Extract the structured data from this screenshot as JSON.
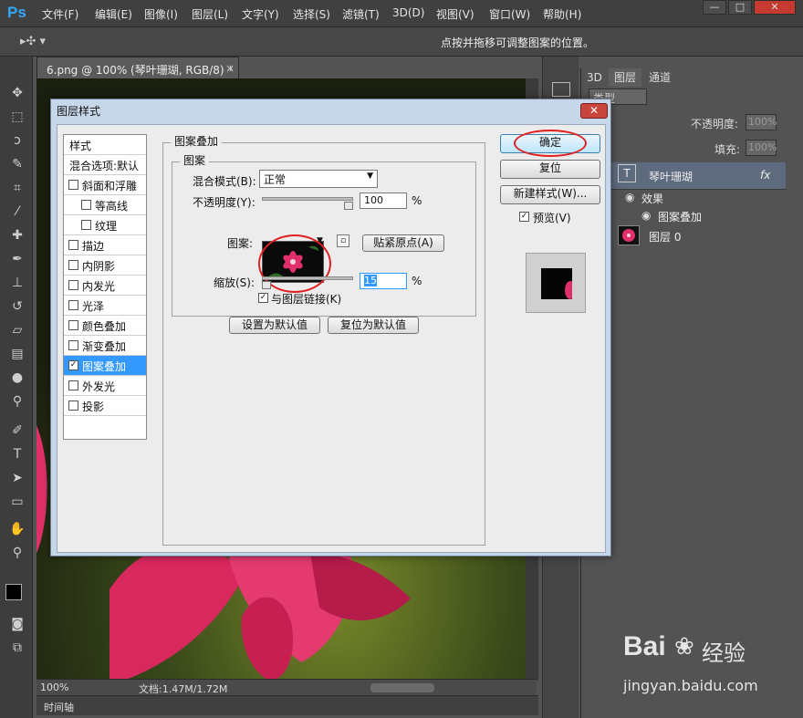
{
  "app": {
    "logo": "Ps"
  },
  "menu": [
    "文件(F)",
    "编辑(E)",
    "图像(I)",
    "图层(L)",
    "文字(Y)",
    "选择(S)",
    "滤镜(T)",
    "3D(D)",
    "视图(V)",
    "窗口(W)",
    "帮助(H)"
  ],
  "window_controls": {
    "minimize": "—",
    "maximize": "□",
    "close": "✕"
  },
  "options_bar": {
    "hint": "点按并拖移可调整图案的位置。"
  },
  "document": {
    "tab_title": "6.png @ 100% (琴叶珊瑚, RGB/8) *",
    "tab_close": "×"
  },
  "status": {
    "zoom": "100%",
    "doc_info": "文档:1.47M/1.72M"
  },
  "timeline": {
    "label": "时间轴"
  },
  "panel": {
    "tabs": [
      "3D",
      "图层",
      "通道"
    ],
    "filter_kind": "类型",
    "opacity_label": "不透明度:",
    "opacity_value": "100%",
    "fill_label": "填充:",
    "fill_value": "100%",
    "layers": [
      {
        "name": "琴叶珊瑚",
        "fx": "fx"
      },
      {
        "name": "效果"
      },
      {
        "name": "图案叠加"
      },
      {
        "name": "图层 0"
      }
    ]
  },
  "dialog": {
    "title": "图层样式",
    "close": "✕",
    "style_list": {
      "header": "样式",
      "blend": "混合选项:默认",
      "items": [
        {
          "label": "斜面和浮雕",
          "checked": false,
          "indent": false
        },
        {
          "label": "等高线",
          "checked": false,
          "indent": true
        },
        {
          "label": "纹理",
          "checked": false,
          "indent": true
        },
        {
          "label": "描边",
          "checked": false,
          "indent": false
        },
        {
          "label": "内阴影",
          "checked": false,
          "indent": false
        },
        {
          "label": "内发光",
          "checked": false,
          "indent": false
        },
        {
          "label": "光泽",
          "checked": false,
          "indent": false
        },
        {
          "label": "颜色叠加",
          "checked": false,
          "indent": false
        },
        {
          "label": "渐变叠加",
          "checked": false,
          "indent": false
        },
        {
          "label": "图案叠加",
          "checked": true,
          "indent": false,
          "active": true
        },
        {
          "label": "外发光",
          "checked": false,
          "indent": false
        },
        {
          "label": "投影",
          "checked": false,
          "indent": false
        }
      ]
    },
    "section_title": "图案叠加",
    "subsection_title": "图案",
    "blend_mode_label": "混合模式(B):",
    "blend_mode_value": "正常",
    "opacity_label": "不透明度(Y):",
    "opacity_value": "100",
    "opacity_fraction": 1.0,
    "percent": "%",
    "pattern_label": "图案:",
    "snap_origin_button": "贴紧原点(A)",
    "scale_label": "缩放(S):",
    "scale_value": "15",
    "scale_fraction": 0.0,
    "link_label": "与图层链接(K)",
    "link_checked": true,
    "make_default_button": "设置为默认值",
    "reset_default_button": "复位为默认值",
    "ok_button": "确定",
    "reset_button": "复位",
    "new_style_button": "新建样式(W)...",
    "preview_label": "预览(V)",
    "preview_checked": true
  },
  "watermark": {
    "brand": "Bai",
    "brand_suffix": "经验",
    "url": "jingyan.baidu.com"
  },
  "colors": {
    "accent": "#31a8ff",
    "highlight": "#e02020",
    "selection": "#3399ff",
    "flower": "#e0306a"
  }
}
